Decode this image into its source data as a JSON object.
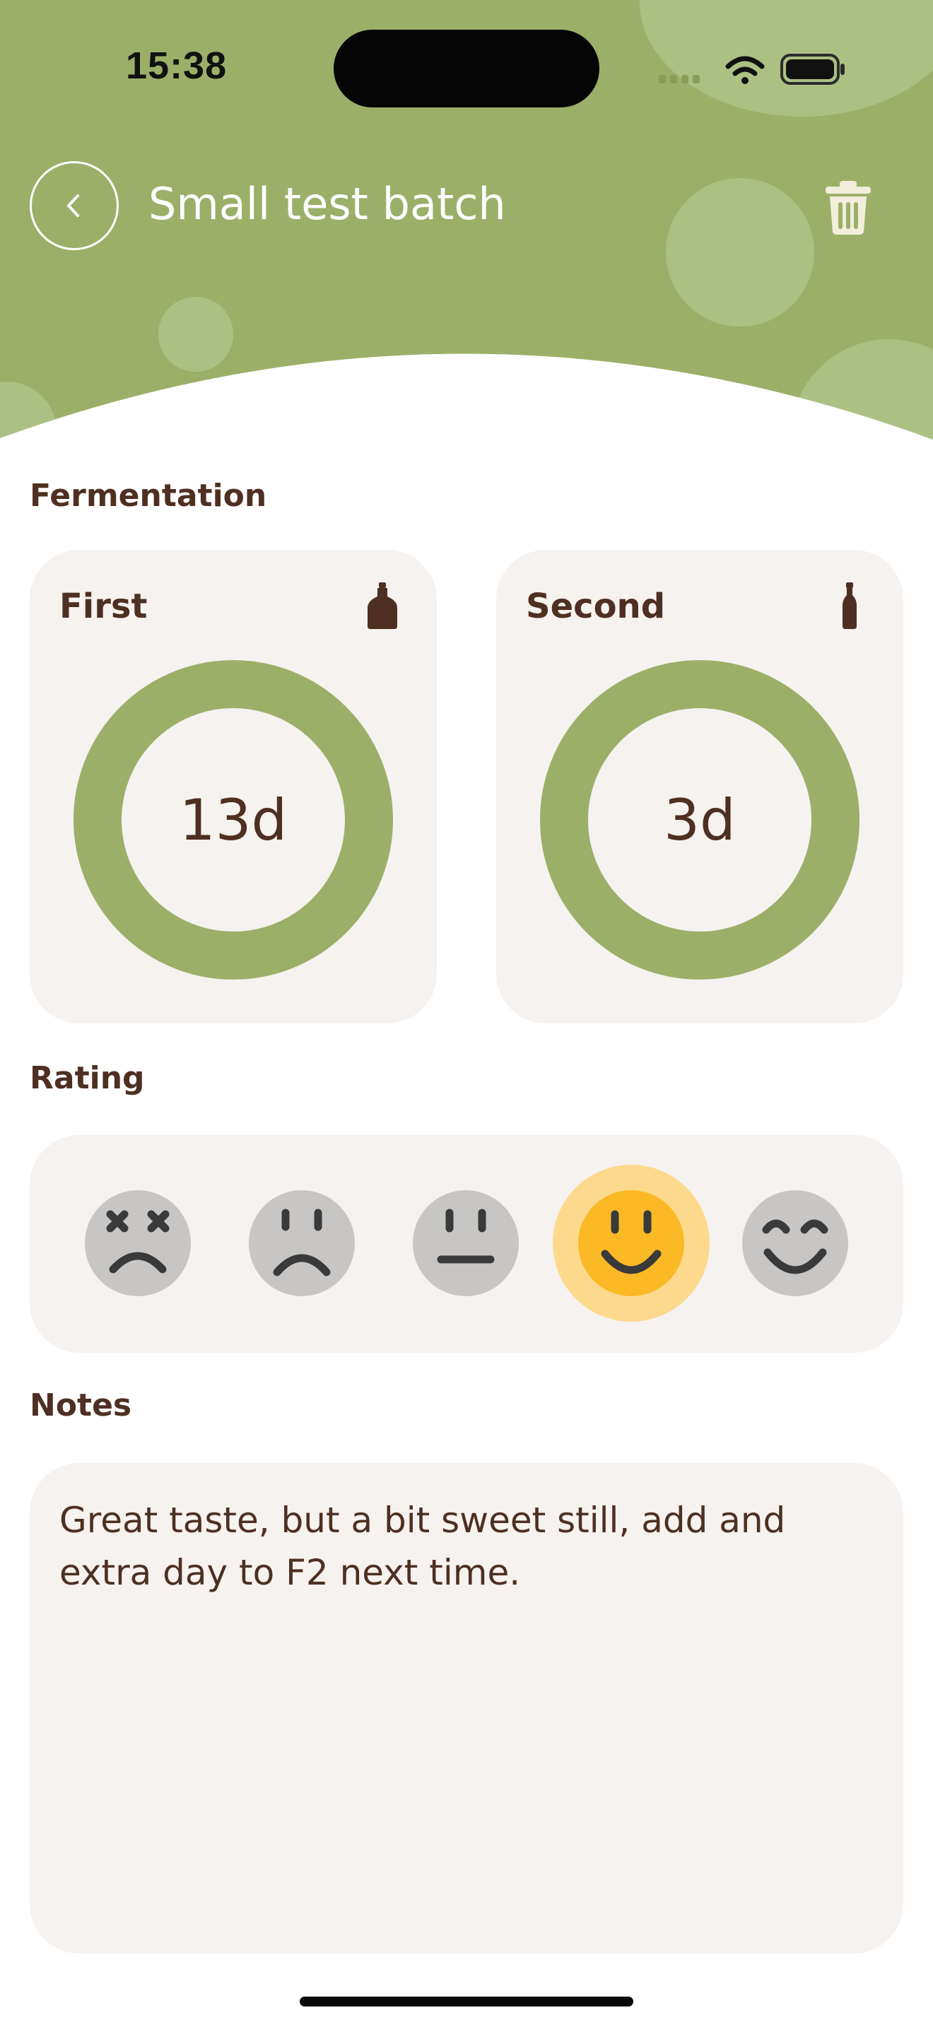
{
  "status_bar": {
    "time": "15:38"
  },
  "header": {
    "title": "Small test batch",
    "back_icon": "chevron-left-icon",
    "delete_icon": "trash-icon"
  },
  "fermentation": {
    "label": "Fermentation",
    "first": {
      "title": "First",
      "value": "13d",
      "icon": "jar-icon",
      "progress": 1.0
    },
    "second": {
      "title": "Second",
      "value": "3d",
      "icon": "bottle-icon",
      "progress": 1.0
    }
  },
  "rating": {
    "label": "Rating",
    "options": [
      "dead-face-icon",
      "sad-face-icon",
      "neutral-face-icon",
      "smile-face-icon",
      "happy-face-icon"
    ],
    "selected_index": 3
  },
  "notes": {
    "label": "Notes",
    "text": "Great taste, but a bit sweet still, add and extra day to F2 next time."
  },
  "colors": {
    "header_green": "#9caf69",
    "ring_green": "#9caf69",
    "brown_text": "#4e2f22",
    "card_bg": "#f6f2ef",
    "selected_face": "#fbb925",
    "selected_halo": "#fdd98d",
    "unselected_face": "#c7c6c5"
  }
}
